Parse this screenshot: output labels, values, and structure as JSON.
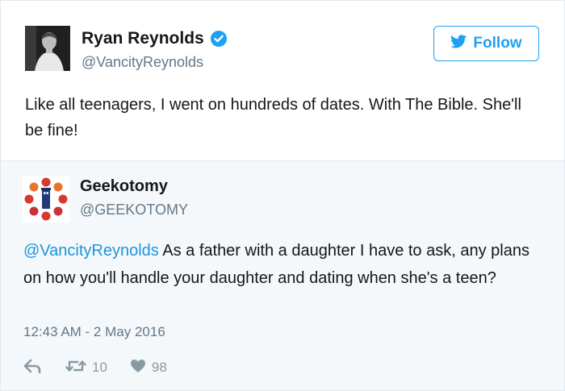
{
  "tweet": {
    "author_name": "Ryan Reynolds",
    "author_handle": "@VancityReynolds",
    "follow_label": "Follow",
    "text": "Like all teenagers, I went on hundreds of dates. With The Bible. She'll be fine!",
    "verified_icon": "verified-badge-icon",
    "accent_color": "#1da1f2"
  },
  "reply": {
    "author_name": "Geekotomy",
    "author_handle": "@GEEKOTOMY",
    "mention": "@VancityReynolds",
    "text": " As a father with a daughter I have to ask, any plans on how you'll handle your daughter and dating when she's a teen?",
    "timestamp": "12:43 AM - 2 May 2016",
    "retweet_count": "10",
    "like_count": "98",
    "mention_color": "#1b95e0"
  }
}
